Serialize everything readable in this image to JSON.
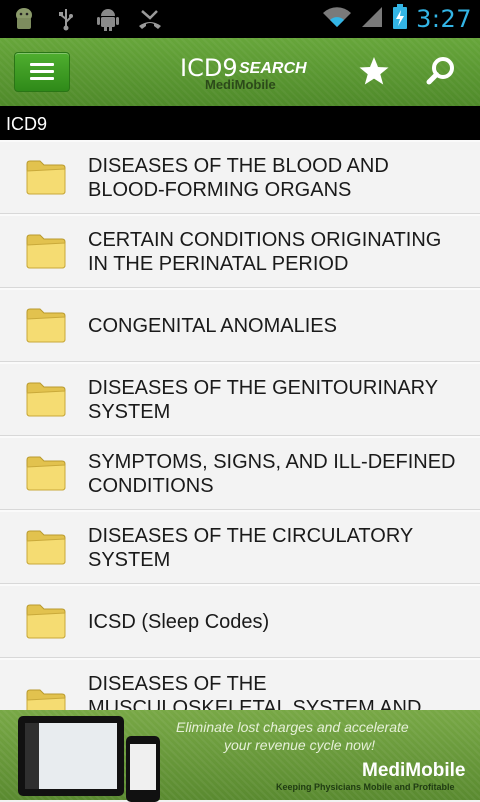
{
  "status_bar": {
    "time": "3:27",
    "icons": [
      "android-debug-icon",
      "usb-icon",
      "android-icon",
      "missed-call-icon",
      "wifi-icon",
      "signal-icon",
      "battery-charging-icon"
    ]
  },
  "app_bar": {
    "logo_main": "ICD9",
    "logo_sub": "SEARCH",
    "logo_brand": "MediMobile",
    "icons": [
      "menu-icon",
      "star-icon",
      "search-icon"
    ]
  },
  "breadcrumb": {
    "label": "ICD9"
  },
  "list": {
    "items": [
      {
        "label": "DISEASES OF THE BLOOD AND BLOOD-FORMING ORGANS"
      },
      {
        "label": "CERTAIN CONDITIONS ORIGINATING IN THE PERINATAL PERIOD"
      },
      {
        "label": "CONGENITAL ANOMALIES"
      },
      {
        "label": "DISEASES OF THE GENITOURINARY SYSTEM"
      },
      {
        "label": "SYMPTOMS, SIGNS, AND ILL-DEFINED CONDITIONS"
      },
      {
        "label": "DISEASES OF THE CIRCULATORY SYSTEM"
      },
      {
        "label": "ICSD (Sleep Codes)"
      },
      {
        "label": "DISEASES OF THE MUSCULOSKELETAL SYSTEM AND"
      }
    ]
  },
  "ad": {
    "line1": "Eliminate lost charges and accelerate",
    "line2": "your revenue cycle now!",
    "brand": "MediMobile",
    "tagline": "Keeping Physicians Mobile and Profitable"
  },
  "colors": {
    "status_bar": "#000000",
    "clock": "#33b5e5",
    "app_bar_green": "#5d9a35",
    "menu_button_green": "#3a9a22",
    "breadcrumb_bar": "#000000",
    "list_background": "#f3f3f3",
    "folder_yellow": "#f2d867"
  }
}
